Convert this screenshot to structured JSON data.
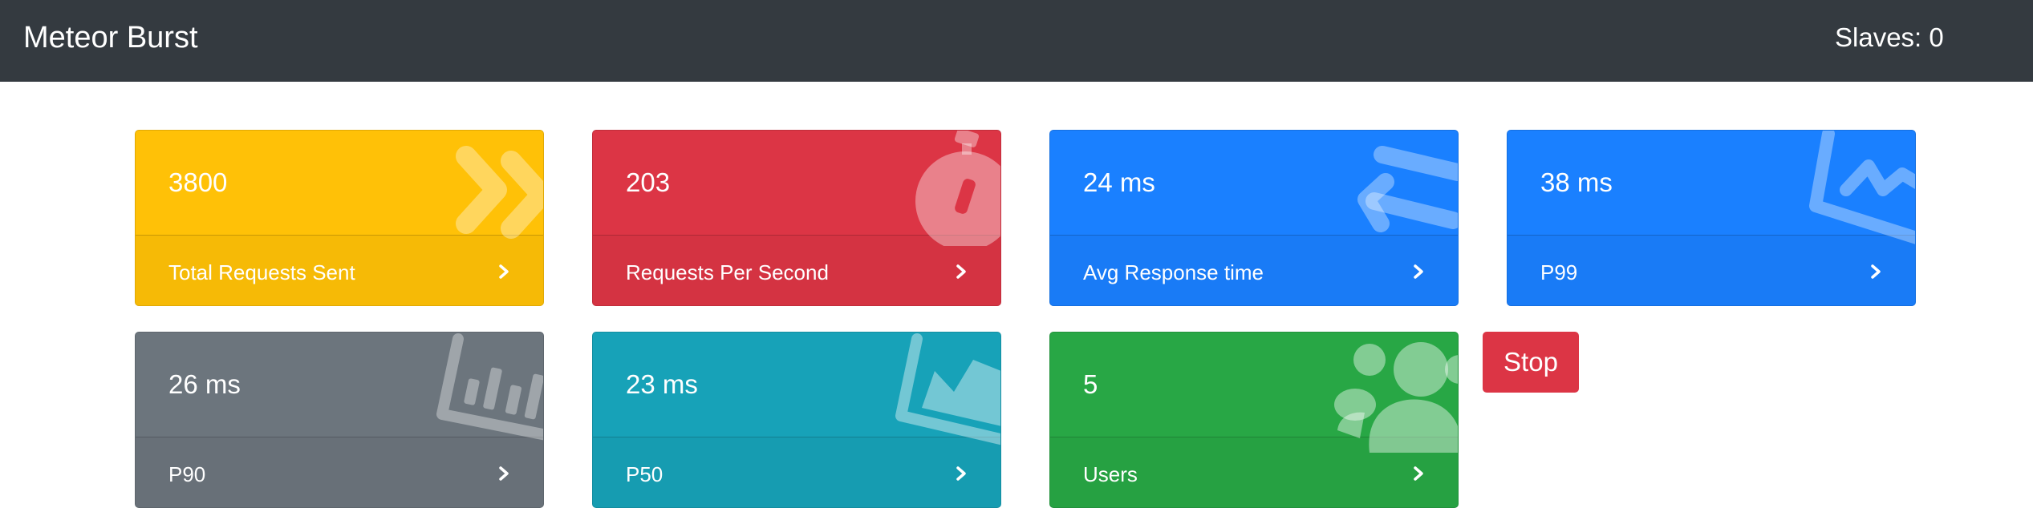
{
  "navbar": {
    "brand": "Meteor Burst",
    "slaves": "Slaves: 0"
  },
  "cards": [
    {
      "value": "3800",
      "label": "Total Requests Sent",
      "color": "#ffc107",
      "icon": "double-chevron-right-icon"
    },
    {
      "value": "203",
      "label": "Requests Per Second",
      "color": "#dc3545",
      "icon": "stopwatch-icon"
    },
    {
      "value": "24 ms",
      "label": "Avg Response time",
      "color": "#1a80ff",
      "icon": "exchange-arrows-icon"
    },
    {
      "value": "38 ms",
      "label": "P99",
      "color": "#1a80ff",
      "icon": "line-chart-icon"
    },
    {
      "value": "26 ms",
      "label": "P90",
      "color": "#6c757d",
      "icon": "bar-chart-icon"
    },
    {
      "value": "23 ms",
      "label": "P50",
      "color": "#17a2b8",
      "icon": "area-chart-icon"
    },
    {
      "value": "5",
      "label": "Users",
      "color": "#28a745",
      "icon": "users-icon"
    }
  ],
  "stop_button": {
    "label": "Stop",
    "color": "#dc3545"
  }
}
